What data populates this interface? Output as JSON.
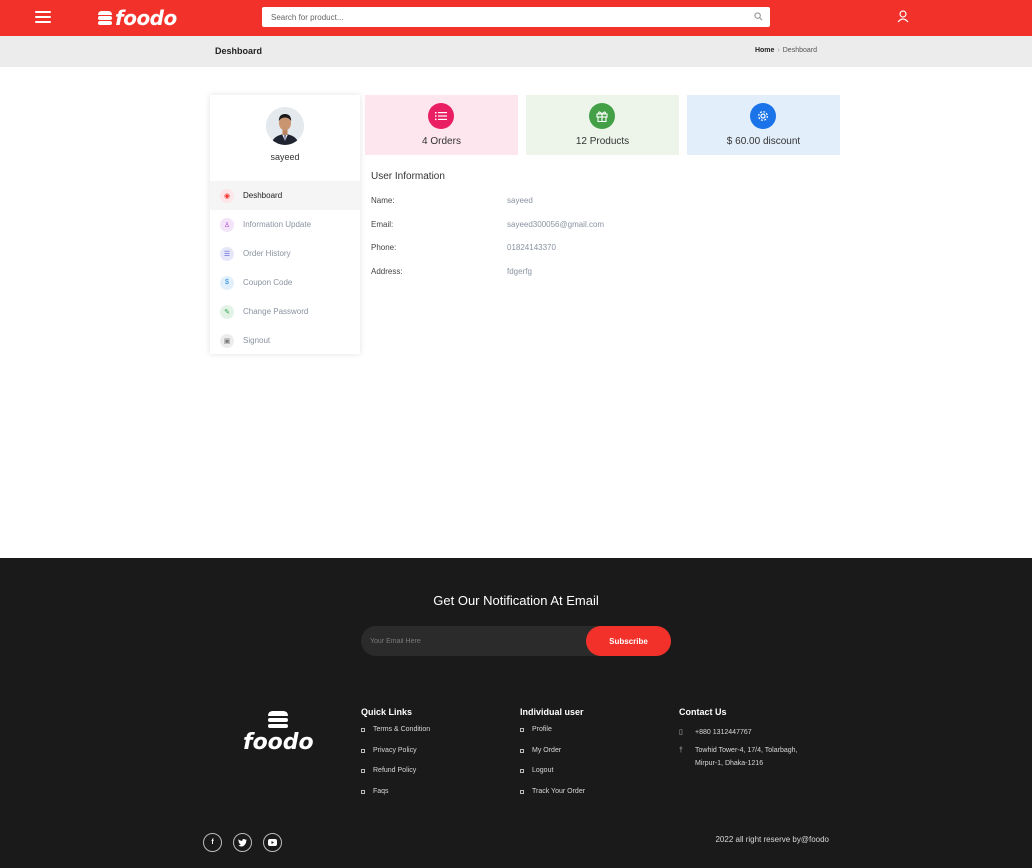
{
  "header": {
    "brand": "foodo",
    "search_placeholder": "Search for product..."
  },
  "breadcrumb": {
    "page_title": "Deshboard",
    "home": "Home",
    "current": "Deshboard"
  },
  "profile": {
    "username": "sayeed",
    "menu": [
      {
        "label": "Deshboard",
        "icon": "dashboard-icon",
        "color": "#f2322a"
      },
      {
        "label": "Information Update",
        "icon": "user-icon",
        "color": "#b04bd6"
      },
      {
        "label": "Order History",
        "icon": "list-icon",
        "color": "#5b5bd6"
      },
      {
        "label": "Coupon Code",
        "icon": "coupon-icon",
        "color": "#2f8fe8"
      },
      {
        "label": "Change Password",
        "icon": "edit-icon",
        "color": "#2da24a"
      },
      {
        "label": "Signout",
        "icon": "lock-icon",
        "color": "#7a7a7a"
      }
    ]
  },
  "stats": [
    {
      "label": "4 Orders",
      "icon": "list-icon",
      "bg": "#fde6ee",
      "accent": "#e91e63"
    },
    {
      "label": "12 Products",
      "icon": "gift-icon",
      "bg": "#edf5ea",
      "accent": "#43a047"
    },
    {
      "label": "$ 60.00 discount",
      "icon": "gear-icon",
      "bg": "#e3eefb",
      "accent": "#1a73e8"
    }
  ],
  "user_info": {
    "title": "User Information",
    "rows": [
      {
        "key": "Name:",
        "value": "sayeed"
      },
      {
        "key": "Email:",
        "value": "sayeed300056@gmail.com"
      },
      {
        "key": "Phone:",
        "value": "01824143370"
      },
      {
        "key": "Address:",
        "value": "fdgerfg"
      }
    ]
  },
  "footer": {
    "newsletter_title": "Get Our Notification At Email",
    "email_placeholder": "Your Email Here",
    "subscribe_label": "Subscribe",
    "brand": "foodo",
    "quick_links": {
      "title": "Quick Links",
      "items": [
        "Terms & Condition",
        "Privacy Policy",
        "Refund Policy",
        "Faqs"
      ]
    },
    "individual_user": {
      "title": "Individual user",
      "items": [
        "Profile",
        "My Order",
        "Logout",
        "Track Your Order"
      ]
    },
    "contact": {
      "title": "Contact Us",
      "phone": "+880 1312447767",
      "address_line1": "Towhid Tower-4, 17/4, Tolarbagh,",
      "address_line2": "Mirpur-1, Dhaka-1216"
    },
    "socials": [
      "facebook-icon",
      "twitter-icon",
      "youtube-icon"
    ],
    "copyright": "2022 all right reserve by@foodo"
  },
  "colors": {
    "brand_red": "#f2322a",
    "footer_bg": "#1a1a1a"
  }
}
